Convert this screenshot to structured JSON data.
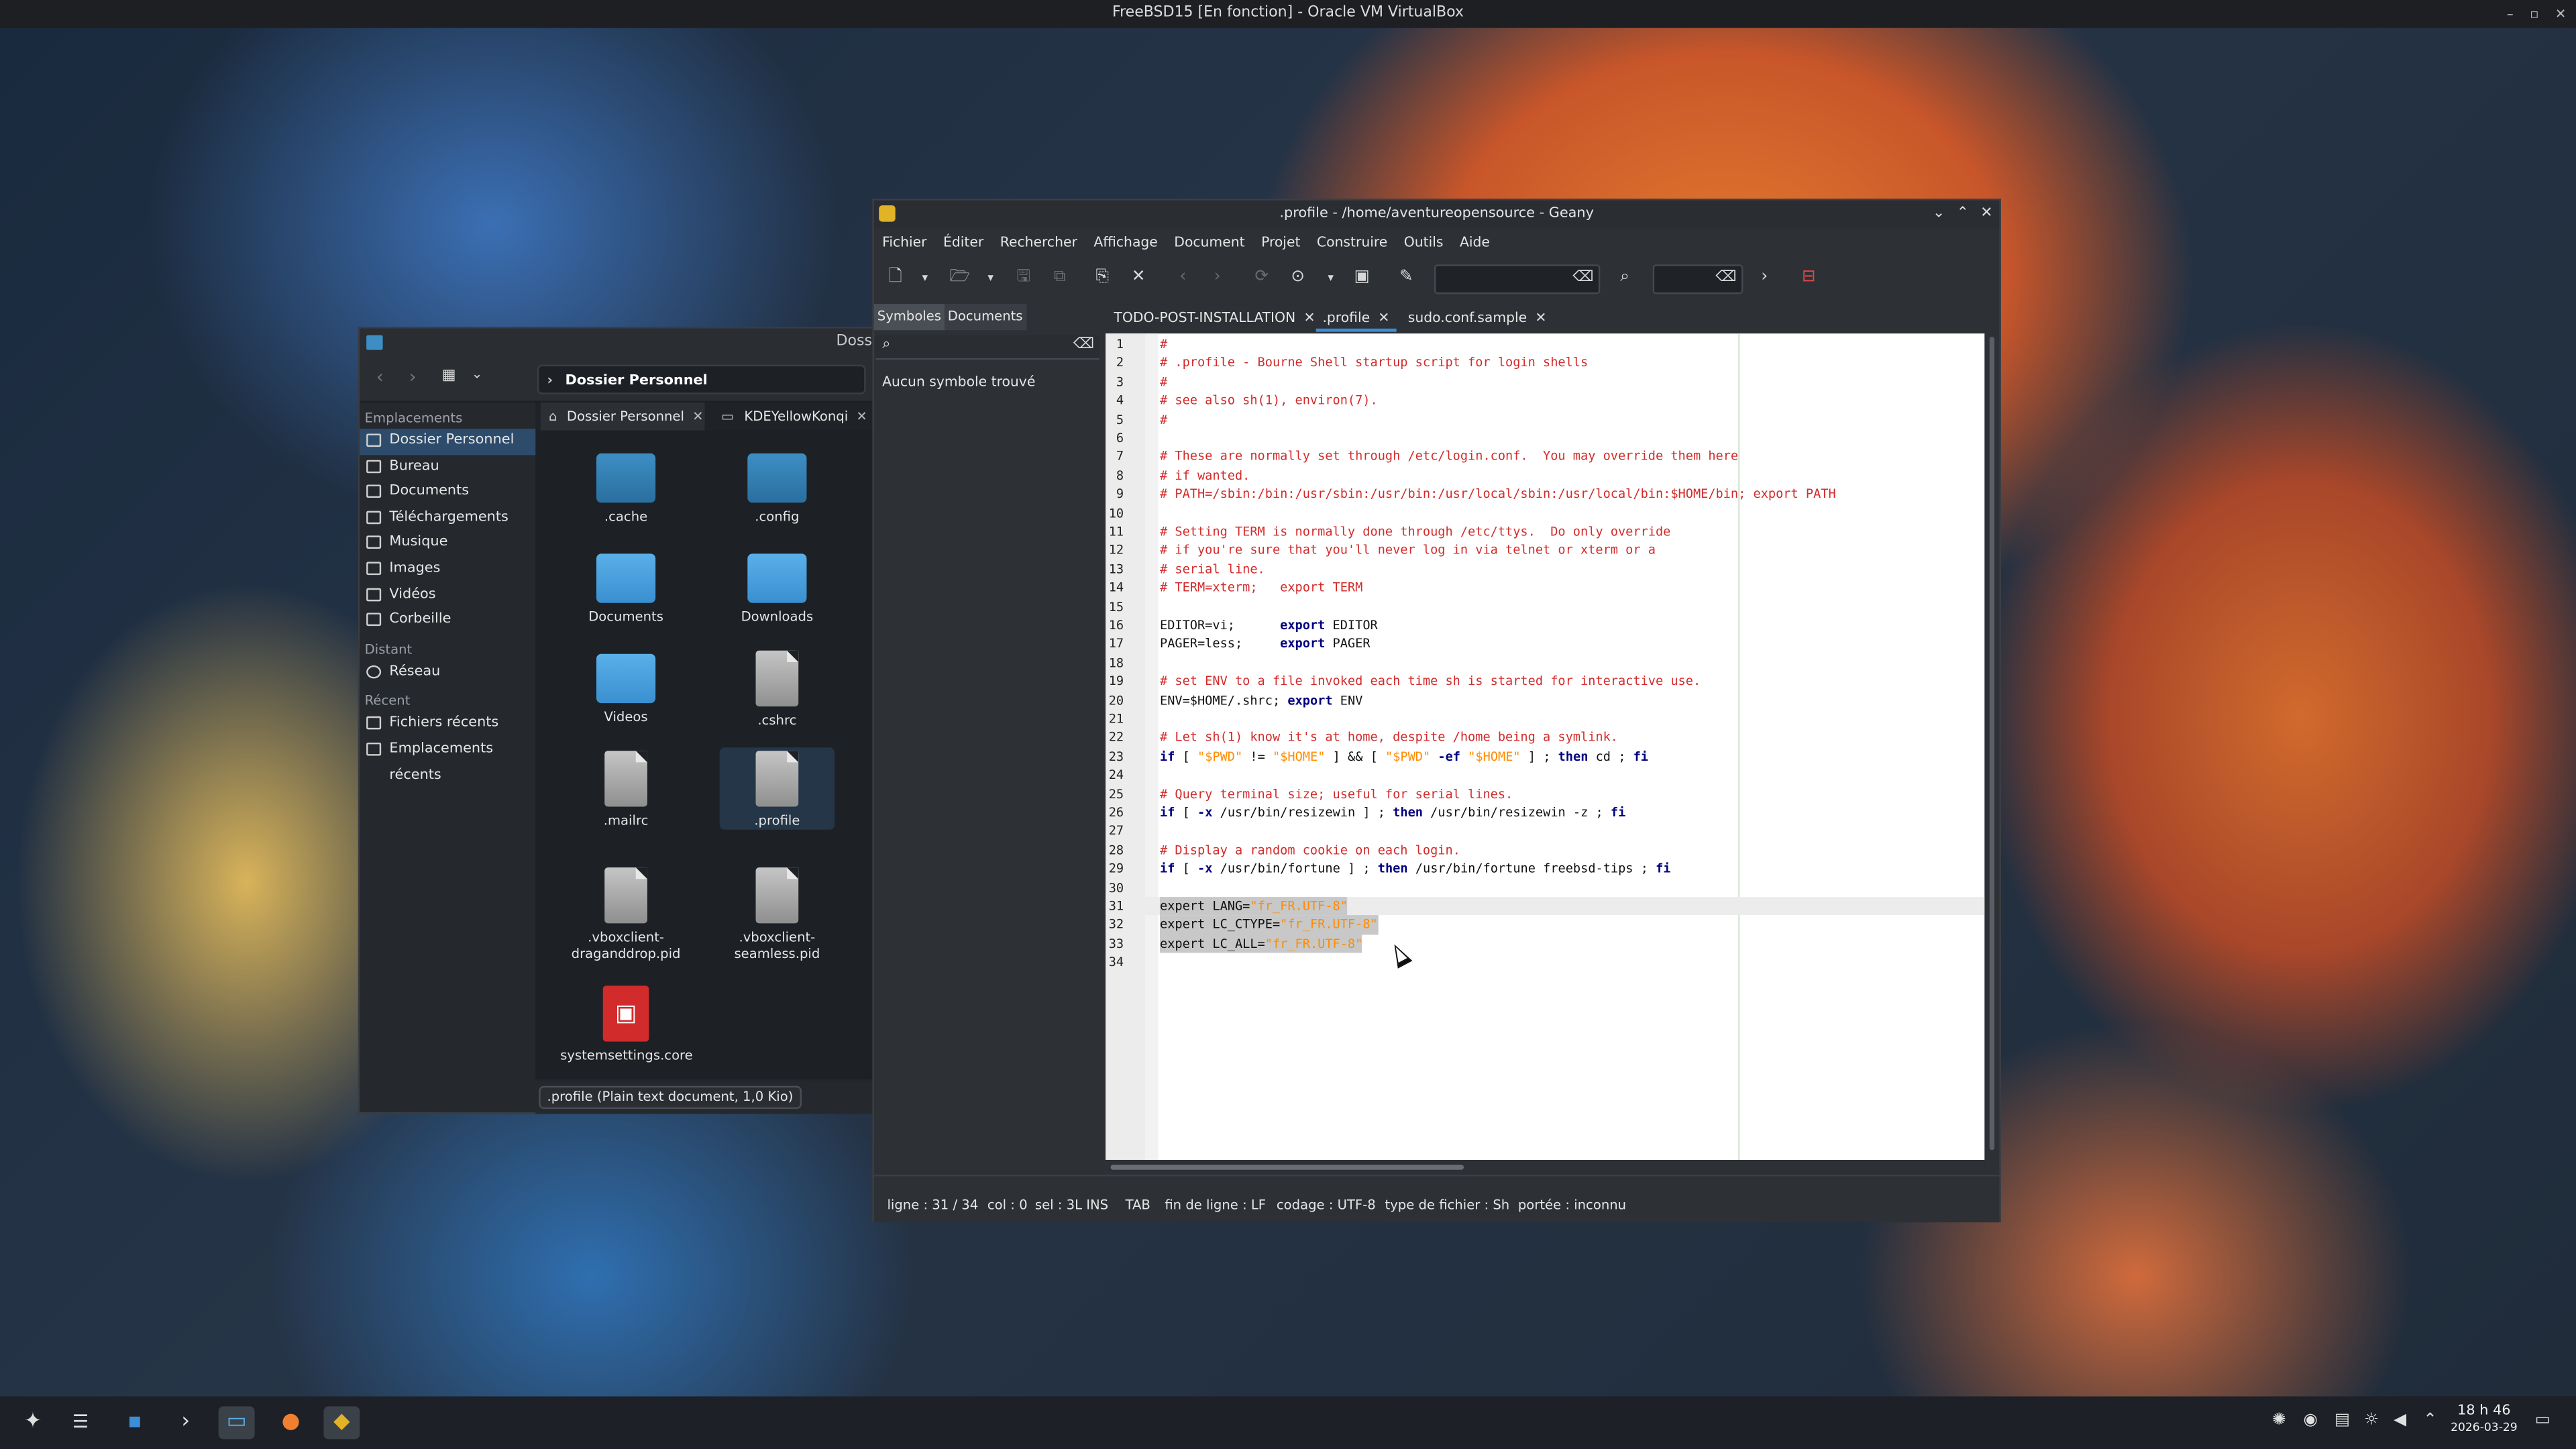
{
  "vbox": {
    "title": "FreeBSD15 [En fonction] - Oracle VM VirtualBox"
  },
  "dolphin": {
    "title": "Dossi",
    "breadcrumb": "Dossier Personnel",
    "places": {
      "header_places": "Emplacements",
      "items": [
        "Dossier Personnel",
        "Bureau",
        "Documents",
        "Téléchargements",
        "Musique",
        "Images",
        "Vidéos",
        "Corbeille"
      ],
      "header_remote": "Distant",
      "remote": [
        "Réseau"
      ],
      "header_recent": "Récent",
      "recent": [
        "Fichiers récents",
        "Emplacements récents"
      ]
    },
    "tabs": [
      {
        "label": "Dossier Personnel"
      },
      {
        "label": "KDEYellowKonqi"
      }
    ],
    "files": [
      ".cache",
      ".config",
      "Documents",
      "Downloads",
      "Videos",
      ".cshrc",
      ".mailrc",
      ".profile",
      ".vboxclient-draganddrop.pid",
      ".vboxclient-seamless.pid",
      "systemsettings.core"
    ],
    "status": ".profile (Plain text document, 1,0 Kio)"
  },
  "geany": {
    "title": ".profile - /home/aventureopensource - Geany",
    "menu": [
      "Fichier",
      "Éditer",
      "Rechercher",
      "Affichage",
      "Document",
      "Projet",
      "Construire",
      "Outils",
      "Aide"
    ],
    "side_tabs": [
      "Symboles",
      "Documents"
    ],
    "side_message": "Aucun symbole trouvé",
    "doc_tabs": [
      "TODO-POST-INSTALLATION",
      ".profile",
      "sudo.conf.sample"
    ],
    "lines": [
      [
        [
          "c",
          "#"
        ]
      ],
      [
        [
          "c",
          "# .profile - Bourne Shell startup script for login shells"
        ]
      ],
      [
        [
          "c",
          "#"
        ]
      ],
      [
        [
          "c",
          "# see also sh(1), environ(7)."
        ]
      ],
      [
        [
          "c",
          "#"
        ]
      ],
      [],
      [
        [
          "c",
          "# These are normally set through /etc/login.conf.  You may override them here"
        ]
      ],
      [
        [
          "c",
          "# if wanted."
        ]
      ],
      [
        [
          "c",
          "# PATH=/sbin:/bin:/usr/sbin:/usr/bin:/usr/local/sbin:/usr/local/bin:$HOME/bin; export PATH"
        ]
      ],
      [],
      [
        [
          "c",
          "# Setting TERM is normally done through /etc/ttys.  Do only override"
        ]
      ],
      [
        [
          "c",
          "# if you're sure that you'll never log in via telnet or xterm or a"
        ]
      ],
      [
        [
          "c",
          "# serial line."
        ]
      ],
      [
        [
          "c",
          "# TERM=xterm;   export TERM"
        ]
      ],
      [],
      [
        [
          "p",
          "EDITOR=vi;      "
        ],
        [
          "k",
          "export"
        ],
        [
          "p",
          " EDITOR"
        ]
      ],
      [
        [
          "p",
          "PAGER=less;     "
        ],
        [
          "k",
          "export"
        ],
        [
          "p",
          " PAGER"
        ]
      ],
      [],
      [
        [
          "c",
          "# set ENV to a file invoked each time sh is started for interactive use."
        ]
      ],
      [
        [
          "p",
          "ENV=$HOME/.shrc; "
        ],
        [
          "k",
          "export"
        ],
        [
          "p",
          " ENV"
        ]
      ],
      [],
      [
        [
          "c",
          "# Let sh(1) know it's at home, despite /home being a symlink."
        ]
      ],
      [
        [
          "k",
          "if"
        ],
        [
          "p",
          " [ "
        ],
        [
          "s",
          "\"$PWD\""
        ],
        [
          "p",
          " != "
        ],
        [
          "s",
          "\"$HOME\""
        ],
        [
          "p",
          " ] && [ "
        ],
        [
          "s",
          "\"$PWD\""
        ],
        [
          "p",
          " "
        ],
        [
          "k",
          "-ef"
        ],
        [
          "p",
          " "
        ],
        [
          "s",
          "\"$HOME\""
        ],
        [
          "p",
          " ] ; "
        ],
        [
          "k",
          "then"
        ],
        [
          "p",
          " cd ; "
        ],
        [
          "k",
          "fi"
        ]
      ],
      [],
      [
        [
          "c",
          "# Query terminal size; useful for serial lines."
        ]
      ],
      [
        [
          "k",
          "if"
        ],
        [
          "p",
          " [ "
        ],
        [
          "k",
          "-x"
        ],
        [
          "p",
          " /usr/bin/resizewin ] ; "
        ],
        [
          "k",
          "then"
        ],
        [
          "p",
          " /usr/bin/resizewin -z ; "
        ],
        [
          "k",
          "fi"
        ]
      ],
      [],
      [
        [
          "c",
          "# Display a random cookie on each login."
        ]
      ],
      [
        [
          "k",
          "if"
        ],
        [
          "p",
          " [ "
        ],
        [
          "k",
          "-x"
        ],
        [
          "p",
          " /usr/bin/fortune ] ; "
        ],
        [
          "k",
          "then"
        ],
        [
          "p",
          " /usr/bin/fortune freebsd-tips ; "
        ],
        [
          "k",
          "fi"
        ]
      ],
      [],
      [
        [
          "p",
          "expert LANG="
        ],
        [
          "s",
          "\"fr_FR.UTF-8\""
        ]
      ],
      [
        [
          "p",
          "expert LC_CTYPE="
        ],
        [
          "s",
          "\"fr_FR.UTF-8\""
        ]
      ],
      [
        [
          "p",
          "expert LC_ALL="
        ],
        [
          "s",
          "\"fr_FR.UTF-8\""
        ]
      ],
      []
    ],
    "status": {
      "line": "ligne : 31 / 34",
      "col": "col : 0",
      "sel": "sel : 3L INS",
      "tab": "TAB",
      "eol": "fin de ligne : LF",
      "enc": "codage : UTF-8",
      "ftype": "type de fichier : Sh",
      "scope": "portée : inconnu"
    }
  },
  "taskbar": {
    "time": "18 h 46",
    "date": "2026-03-29"
  }
}
